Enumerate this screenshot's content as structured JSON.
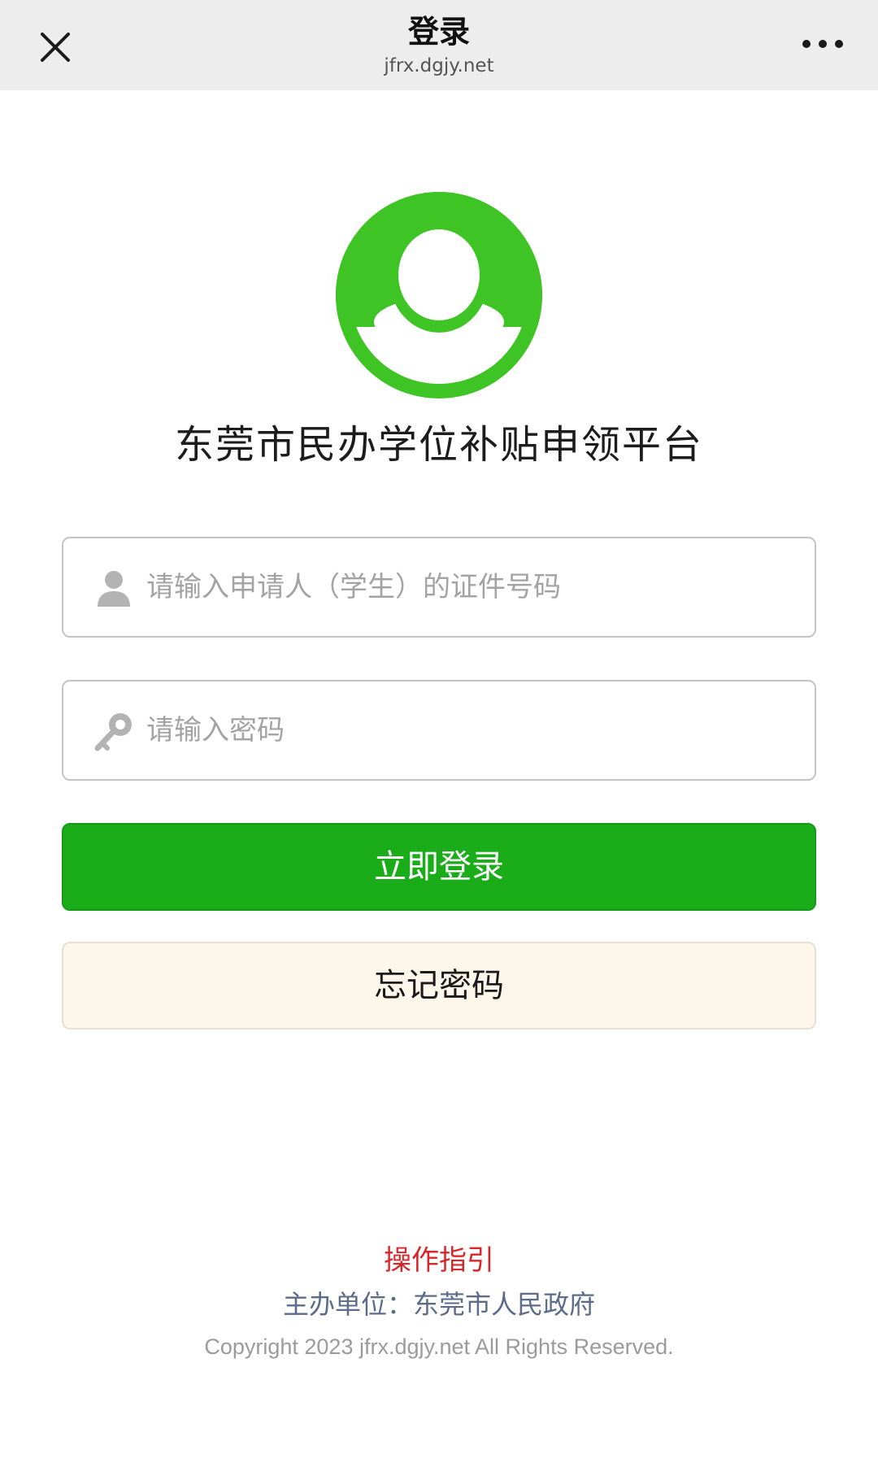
{
  "navbar": {
    "title": "登录",
    "subtitle": "jfrx.dgjy.net"
  },
  "app": {
    "title": "东莞市民办学位补贴申领平台"
  },
  "form": {
    "id_placeholder": "请输入申请人（学生）的证件号码",
    "id_value": "",
    "password_placeholder": "请输入密码",
    "password_value": ""
  },
  "buttons": {
    "login_label": "立即登录",
    "forgot_label": "忘记密码"
  },
  "footer": {
    "guide_link": "操作指引",
    "host": "主办单位：东莞市人民政府",
    "copyright": "Copyright 2023 jfrx.dgjy.net All Rights Reserved."
  },
  "colors": {
    "nav_bg": "#ededed",
    "brand_green": "#1aad19",
    "avatar_green": "#3fc426",
    "forgot_bg": "#fdf6ea",
    "guide_red": "#d9262b",
    "host_blue_gray": "#5d6b8a"
  },
  "icons": {
    "nav_close": "close-icon",
    "nav_more": "more-icon",
    "avatar": "user-avatar-icon",
    "id_field": "user-icon",
    "password_field": "key-icon"
  }
}
